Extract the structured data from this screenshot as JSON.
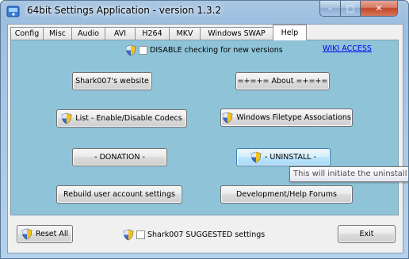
{
  "window": {
    "title": "64bit Settings Application - version 1.3.2",
    "controls": {
      "minimize": "–",
      "maximize": "□",
      "close": "✕"
    }
  },
  "tabs": [
    {
      "label": "Config"
    },
    {
      "label": "Misc"
    },
    {
      "label": "Audio"
    },
    {
      "label": "AVI"
    },
    {
      "label": "H264"
    },
    {
      "label": "MKV"
    },
    {
      "label": "Windows SWAP"
    },
    {
      "label": "Help",
      "active": true
    }
  ],
  "help_panel": {
    "disable_check_label": "DISABLE checking for new versions",
    "disable_check_checked": false,
    "wiki_link": "WIKI   ACCESS",
    "buttons": {
      "website": "Shark007's website",
      "about": "=+=+= About =+=+=",
      "codecs": "List - Enable/Disable Codecs",
      "filetype": "Windows Filetype Associations",
      "donation": "- DONATION -",
      "uninstall": "- UNINSTALL -",
      "rebuild": "Rebuild user account settings",
      "forums": "Development/Help Forums"
    },
    "tooltip": "This will initiate the uninstall"
  },
  "footer": {
    "reset_all": "Reset All",
    "suggested_label": "Shark007 SUGGESTED settings",
    "suggested_checked": false,
    "exit": "Exit"
  },
  "icons": [
    "app-icon",
    "uac-shield-icon"
  ],
  "colors": {
    "panel_bg": "#8fc3d8",
    "link": "#0000ee",
    "hover_button": "#bee6fd"
  }
}
